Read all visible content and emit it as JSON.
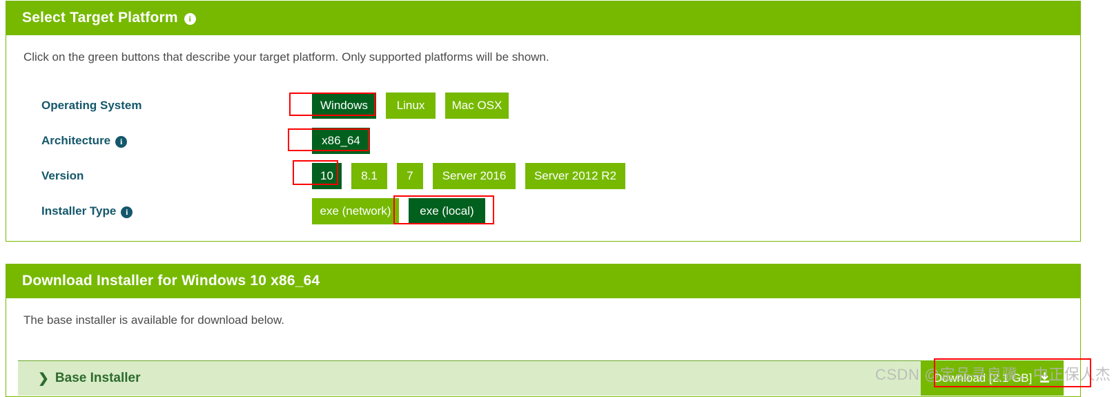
{
  "colors": {
    "brand_green": "#76b900",
    "selected_green": "#01601d",
    "label_teal": "#14576b",
    "annotation_red": "#ff0000",
    "base_bar_bg": "#d9ecc7",
    "base_bar_text": "#2e6b2e"
  },
  "platform_panel": {
    "header_title": "Select Target Platform",
    "header_info_icon": "info-icon",
    "intro_text": "Click on the green buttons that describe your target platform. Only supported platforms will be shown.",
    "rows": [
      {
        "label": "Operating System",
        "has_info": false,
        "info_icon": "info-icon",
        "options": [
          {
            "label": "Windows",
            "selected": true
          },
          {
            "label": "Linux",
            "selected": false
          },
          {
            "label": "Mac OSX",
            "selected": false
          }
        ]
      },
      {
        "label": "Architecture",
        "has_info": true,
        "info_icon": "info-icon",
        "options": [
          {
            "label": "x86_64",
            "selected": true
          }
        ]
      },
      {
        "label": "Version",
        "has_info": false,
        "info_icon": "info-icon",
        "options": [
          {
            "label": "10",
            "selected": true
          },
          {
            "label": "8.1",
            "selected": false
          },
          {
            "label": "7",
            "selected": false
          },
          {
            "label": "Server 2016",
            "selected": false
          },
          {
            "label": "Server 2012 R2",
            "selected": false
          }
        ]
      },
      {
        "label": "Installer Type",
        "has_info": true,
        "info_icon": "info-icon",
        "options": [
          {
            "label": "exe (network)",
            "selected": false
          },
          {
            "label": "exe (local)",
            "selected": true
          }
        ]
      }
    ]
  },
  "download_panel": {
    "header_title": "Download Installer for Windows 10 x86_64",
    "intro_text": "The base installer is available for download below.",
    "base_installer": {
      "chevron_icon": "chevron-right-icon",
      "chevron_glyph": "❯",
      "label": "Base Installer",
      "download_button_label": "Download [2.1 GB]",
      "download_icon": "download-icon"
    }
  },
  "watermark": {
    "text": "CSDN @定品寻良骥，中正保人杰"
  }
}
